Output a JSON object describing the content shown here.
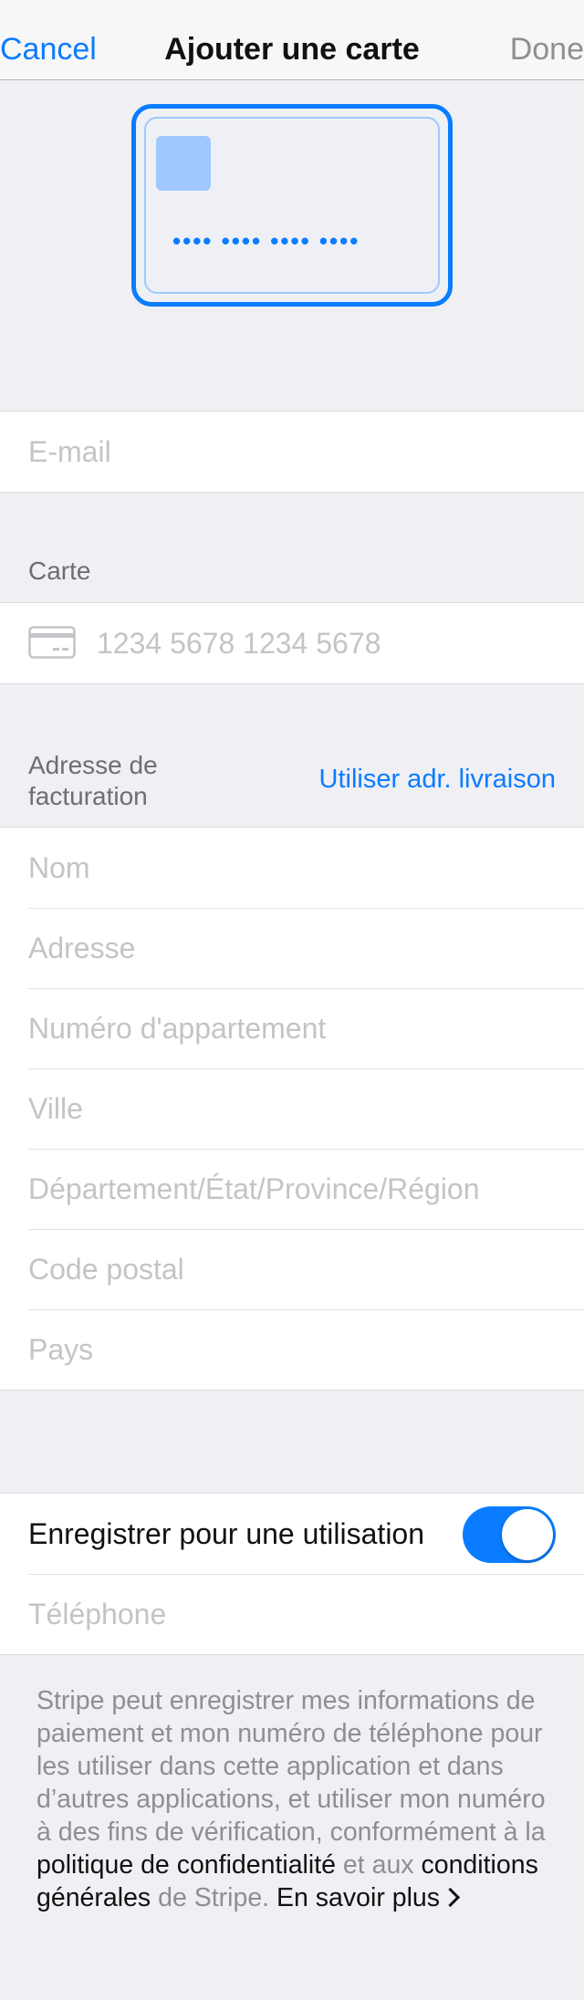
{
  "nav": {
    "cancel": "Cancel",
    "title": "Ajouter une carte",
    "done": "Done"
  },
  "card_illustration": {
    "number_mask": "•••• •••• •••• ••••"
  },
  "email": {
    "placeholder": "E-mail",
    "value": ""
  },
  "card_section": {
    "label": "Carte",
    "placeholder": "1234 5678 1234 5678",
    "icon": "credit-card-icon"
  },
  "billing": {
    "label": "Adresse de facturation",
    "use_shipping": "Utiliser adr. livraison",
    "fields": [
      {
        "placeholder": "Nom"
      },
      {
        "placeholder": "Adresse"
      },
      {
        "placeholder": "Numéro d'appartement"
      },
      {
        "placeholder": "Ville"
      },
      {
        "placeholder": "Département/État/Province/Région"
      },
      {
        "placeholder": "Code postal"
      },
      {
        "placeholder": "Pays"
      }
    ]
  },
  "save": {
    "label": "Enregistrer pour une utilisation",
    "toggle_on": true,
    "phone_placeholder": "Téléphone"
  },
  "footer": {
    "part1": "Stripe peut enregistrer mes informations de paiement et mon numéro de téléphone pour les utiliser dans cette application et dans d’autres applications, et utiliser mon numéro à des fins de vérification, conformément à la ",
    "privacy_link": "politique de confidentialité",
    "part2": " et aux ",
    "terms_link": "conditions générales",
    "part3": " de Stripe. ",
    "learn_more": "En savoir plus"
  },
  "colors": {
    "accent": "#0a7cff",
    "background": "#efeff4",
    "placeholder": "#c4c4c8",
    "secondary_text": "#6d6d72"
  }
}
